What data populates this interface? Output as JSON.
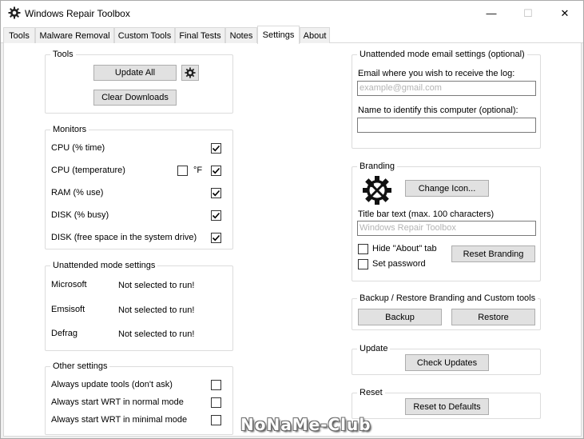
{
  "window": {
    "title": "Windows Repair Toolbox",
    "app_icon": "gear-icon",
    "controls": {
      "minimize": "—",
      "maximize": "☐",
      "close": "✕"
    }
  },
  "tabs": [
    {
      "label": "Tools",
      "active": false
    },
    {
      "label": "Malware Removal",
      "active": false
    },
    {
      "label": "Custom Tools",
      "active": false
    },
    {
      "label": "Final Tests",
      "active": false
    },
    {
      "label": "Notes",
      "active": false
    },
    {
      "label": "Settings",
      "active": true
    },
    {
      "label": "About",
      "active": false
    }
  ],
  "tools": {
    "title": "Tools",
    "update_all": "Update All",
    "clear_downloads": "Clear Downloads",
    "settings_icon": "gear-icon"
  },
  "monitors": {
    "title": "Monitors",
    "items": [
      {
        "label": "CPU (% time)",
        "checked": true
      },
      {
        "label": "CPU (temperature)",
        "checked": true
      },
      {
        "label": "RAM (% use)",
        "checked": true
      },
      {
        "label": "DISK (% busy)",
        "checked": true
      },
      {
        "label": "DISK (free space in the system drive)",
        "checked": true
      }
    ],
    "fahrenheit_label": "°F",
    "fahrenheit_checked": false
  },
  "unattended": {
    "title": "Unattended mode settings",
    "rows": [
      {
        "name": "Microsoft",
        "status": "Not selected to run!"
      },
      {
        "name": "Emsisoft",
        "status": "Not selected to run!"
      },
      {
        "name": "Defrag",
        "status": "Not selected to run!"
      }
    ]
  },
  "other": {
    "title": "Other settings",
    "items": [
      {
        "label": "Always update tools (don't ask)",
        "checked": false
      },
      {
        "label": "Always start WRT in normal mode",
        "checked": false
      },
      {
        "label": "Always start WRT in minimal mode",
        "checked": false
      }
    ]
  },
  "email": {
    "title": "Unattended mode email settings (optional)",
    "email_label": "Email where you wish to receive the log:",
    "email_placeholder": "example@gmail.com",
    "name_label": "Name to identify this computer (optional):",
    "name_value": ""
  },
  "branding": {
    "title": "Branding",
    "change_icon": "Change Icon...",
    "title_bar_label": "Title bar text (max. 100 characters)",
    "title_bar_placeholder": "Windows Repair Toolbox",
    "hide_about": "Hide \"About\" tab",
    "hide_about_checked": false,
    "set_password": "Set password",
    "set_password_checked": false,
    "reset_branding": "Reset Branding",
    "logo_icon": "wrench-screwdriver-gear-icon"
  },
  "backup": {
    "title": "Backup / Restore Branding and Custom tools",
    "backup": "Backup",
    "restore": "Restore"
  },
  "update": {
    "title": "Update",
    "check_updates": "Check Updates"
  },
  "reset": {
    "title": "Reset",
    "reset_defaults": "Reset to Defaults"
  },
  "watermark": "NoNaMe-Club"
}
